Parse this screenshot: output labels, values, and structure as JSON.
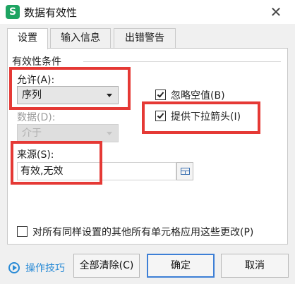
{
  "window": {
    "title": "数据有效性",
    "app_icon_letter": "S",
    "close_glyph": "✕"
  },
  "tabs": [
    {
      "label": "设置",
      "active": true
    },
    {
      "label": "输入信息",
      "active": false
    },
    {
      "label": "出错警告",
      "active": false
    }
  ],
  "criteria": {
    "group_label": "有效性条件",
    "allow_label": "允许(A):",
    "allow_value": "序列",
    "data_label": "数据(D):",
    "data_value": "介于",
    "ignore_blank_label": "忽略空值(B)",
    "ignore_blank_checked": true,
    "dropdown_label": "提供下拉箭头(I)",
    "dropdown_checked": true,
    "source_label": "来源(S):",
    "source_value": "有效,无效"
  },
  "apply_all": {
    "label": "对所有同样设置的其他所有单元格应用这些更改(P)",
    "checked": false
  },
  "footer": {
    "tips_link": "操作技巧",
    "clear_all_button": "全部清除(C)",
    "ok_button": "确定",
    "cancel_button": "取消"
  },
  "colors": {
    "highlight_box": "#e53935",
    "link": "#2a8bd6",
    "app_icon": "#1ea462",
    "primary_border": "#3d7fd6"
  }
}
